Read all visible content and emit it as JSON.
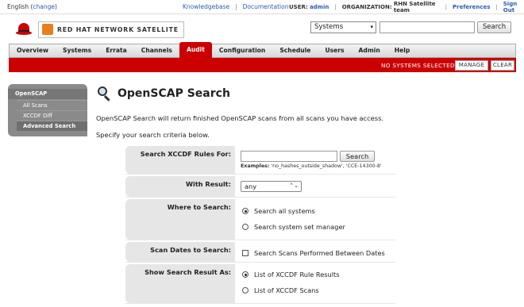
{
  "util": {
    "language": "English",
    "change_label": "change",
    "knowledgebase": "Knowledgebase",
    "documentation": "Documentation",
    "user_label": "USER:",
    "user_value": "admin",
    "org_label": "ORGANIZATION:",
    "org_value": "RHN Satellite team",
    "preferences": "Preferences",
    "sign_out": "Sign Out"
  },
  "brand": {
    "name": "RED HAT NETWORK SATELLITE"
  },
  "header_search": {
    "scope": "Systems",
    "query": "",
    "button": "Search"
  },
  "nav": {
    "tabs": [
      "Overview",
      "Systems",
      "Errata",
      "Channels",
      "Audit",
      "Configuration",
      "Schedule",
      "Users",
      "Admin",
      "Help"
    ],
    "active": "Audit"
  },
  "status": {
    "no_systems": "NO SYSTEMS SELECTED",
    "manage": "MANAGE",
    "clear": "CLEAR"
  },
  "sidebar": {
    "head": "OpenSCAP",
    "items": [
      "All Scans",
      "XCCDF Diff",
      "Advanced Search"
    ],
    "active": "Advanced Search"
  },
  "page": {
    "title": "OpenSCAP Search",
    "intro": "OpenSCAP Search will return finished OpenSCAP scans from all scans you have access.",
    "instructions": "Specify your search criteria below."
  },
  "form": {
    "rules_label": "Search XCCDF Rules For:",
    "rules_value": "",
    "search_button": "Search",
    "examples_label": "Examples:",
    "examples_value": "'no_hashes_outside_shadow', 'CCE-14300-8'",
    "result_label": "With Result:",
    "result_value": "any",
    "where_label": "Where to Search:",
    "where_options": [
      "Search all systems",
      "Search system set manager"
    ],
    "where_selected": 0,
    "dates_label": "Scan Dates to Search:",
    "dates_option": "Search Scans Performed Between Dates",
    "dates_checked": false,
    "show_label": "Show Search Result As:",
    "show_options": [
      "List of XCCDF Rule Results",
      "List of XCCDF Scans"
    ],
    "show_selected": 0
  }
}
